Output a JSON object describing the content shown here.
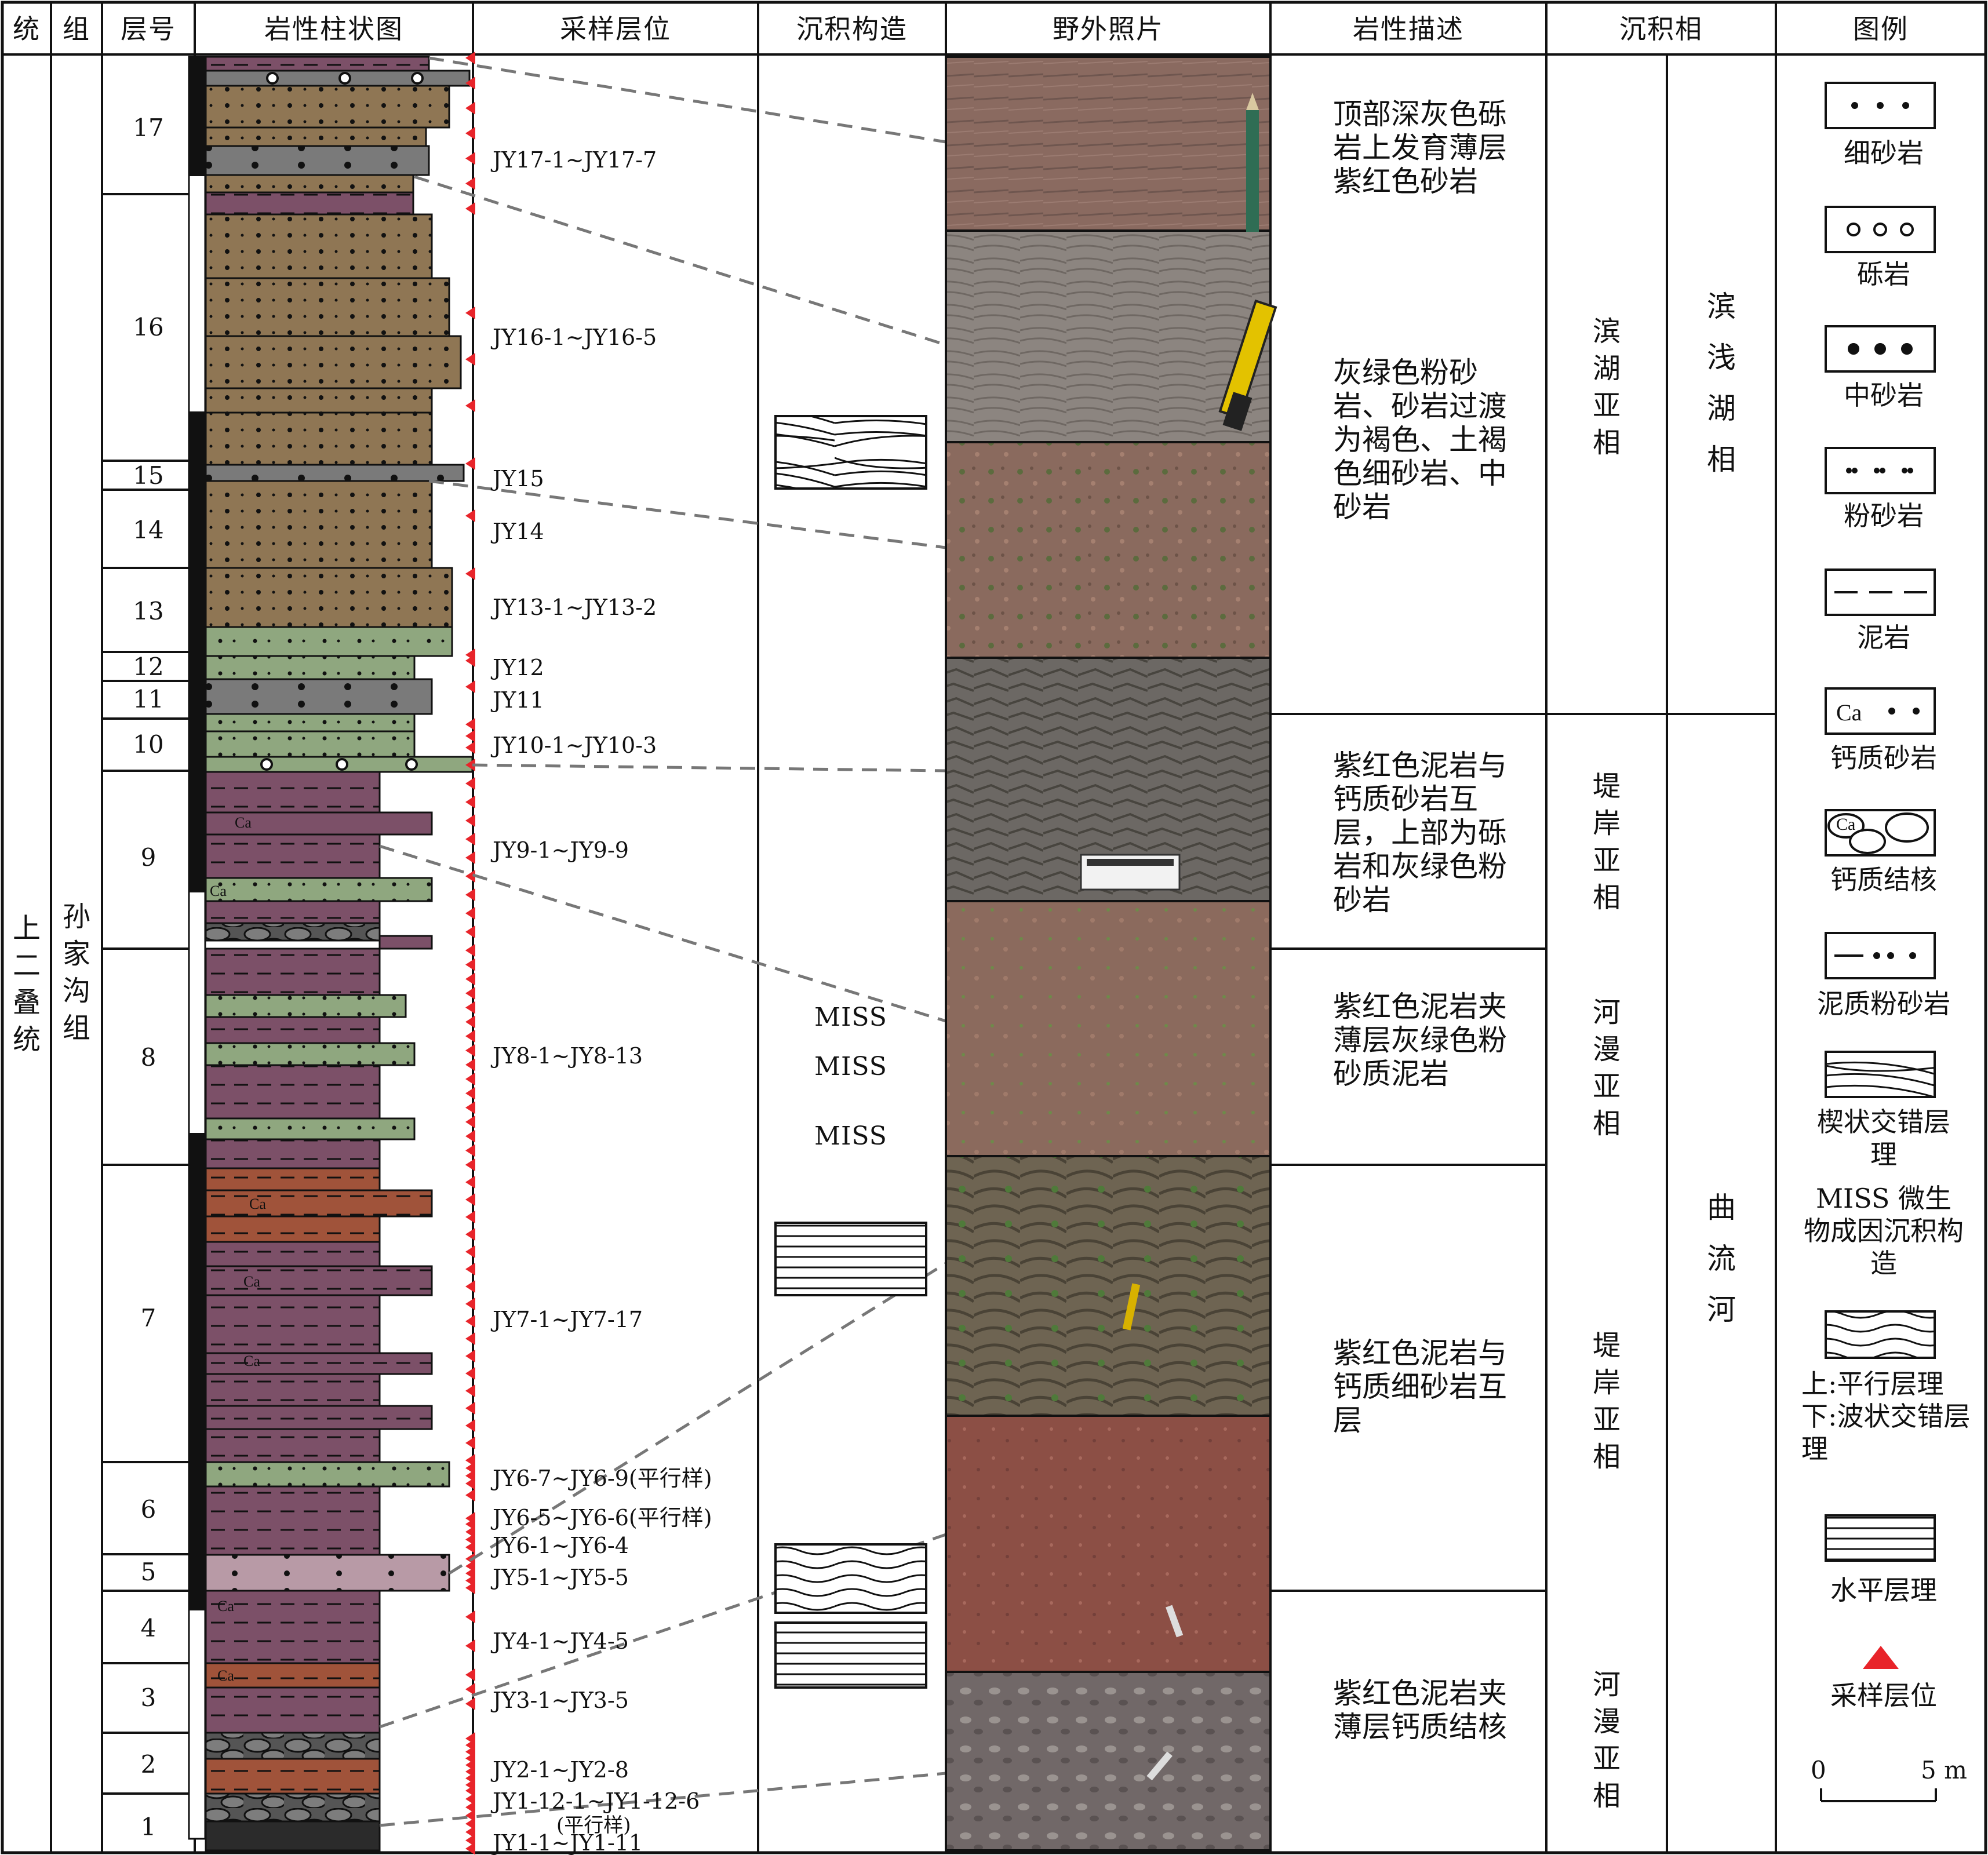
{
  "headers": {
    "series": "统",
    "formation": "组",
    "layer_no": "层号",
    "lithology_column": "岩性柱状图",
    "sample_position": "采样层位",
    "sedimentary_structure": "沉积构造",
    "field_photo": "野外照片",
    "lithology_description": "岩性描述",
    "sedimentary_facies": "沉积相",
    "legend": "图例"
  },
  "series_name": "上二叠统",
  "formation_name": "孙家沟组",
  "layer_numbers": [
    "17",
    "16",
    "15",
    "14",
    "13",
    "12",
    "11",
    "10",
    "9",
    "8",
    "7",
    "6",
    "5",
    "4",
    "3",
    "2",
    "1"
  ],
  "samples": [
    "JY17-1~JY17-7",
    "JY16-1~JY16-5",
    "JY15",
    "JY14",
    "JY13-1~JY13-2",
    "JY12",
    "JY11",
    "JY10-1~JY10-3",
    "JY9-1~JY9-9",
    "JY8-1~JY8-13",
    "JY7-1~JY7-17",
    "JY6-7~JY6-9(平行样)",
    "JY6-5~JY6-6(平行样)",
    "JY6-1~JY6-4",
    "JY5-1~JY5-5",
    "JY4-1~JY4-5",
    "JY3-1~JY3-5",
    "JY2-1~JY2-8",
    "JY1-12-1~JY1-12-6",
    "(平行样)",
    "JY1-1~JY1-11"
  ],
  "miss_labels": [
    "MISS",
    "MISS",
    "MISS"
  ],
  "descriptions": [
    "顶部深灰色砾岩上发育薄层紫红色砂岩",
    "灰绿色粉砂岩、砂岩过渡为褐色、土褐色细砂岩、中砂岩",
    "紫红色泥岩与钙质砂岩互层，上部为砾岩和灰绿色粉砂岩",
    "紫红色泥岩夹薄层灰绿色粉砂质泥岩",
    "紫红色泥岩与钙质细砂岩互层",
    "紫红色泥岩夹薄层钙质结核"
  ],
  "subfacies": [
    "滨湖亚相",
    "堤岸亚相",
    "河漫亚相",
    "堤岸亚相",
    "河漫亚相"
  ],
  "facies": [
    "滨浅湖相",
    "曲流河"
  ],
  "legend": [
    {
      "label": "细砂岩"
    },
    {
      "label": "砾岩"
    },
    {
      "label": "中砂岩"
    },
    {
      "label": "粉砂岩"
    },
    {
      "label": "泥岩"
    },
    {
      "label": "钙质砂岩",
      "symbol_text": "Ca"
    },
    {
      "label": "钙质结核",
      "symbol_text": "Ca"
    },
    {
      "label": "泥质粉砂岩"
    },
    {
      "label": "楔状交错层理"
    },
    {
      "label": "MISS 微生物成因沉积构造"
    },
    {
      "label": "上:平行层理 下:波状交错层理"
    },
    {
      "label": "水平层理"
    },
    {
      "label": "采样层位"
    }
  ],
  "scale": {
    "zero": "0",
    "max": "5 m"
  },
  "colors": {
    "purple": "#7c5068",
    "brown": "#8f7654",
    "green": "#8fa77f",
    "gray": "#7a7a7a",
    "pink": "#b89aa6",
    "redbrown": "#a0533a",
    "sample_marker": "#e8242a"
  }
}
